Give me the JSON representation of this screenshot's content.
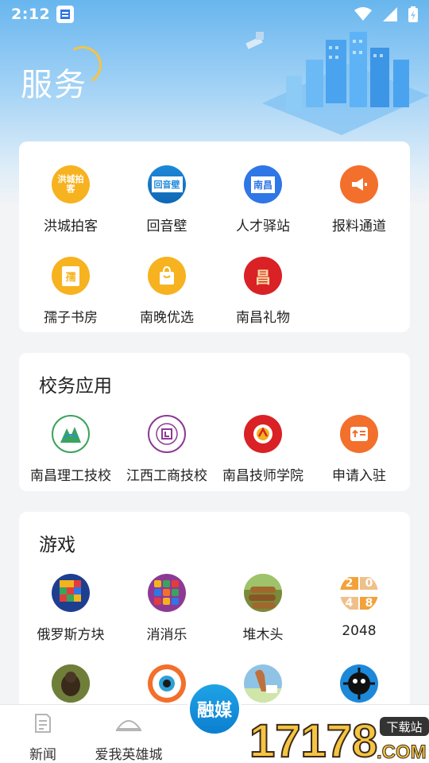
{
  "status_bar": {
    "time": "2:12"
  },
  "page": {
    "title": "服务"
  },
  "services": {
    "items": [
      {
        "label": "洪城拍客",
        "icon": "hongcheng-paike-icon",
        "icon_text": "洪城拍客",
        "color": "#f7b21f"
      },
      {
        "label": "回音壁",
        "icon": "huiyinbi-icon",
        "icon_text": "回音壁",
        "color": "#1e88d8"
      },
      {
        "label": "人才驿站",
        "icon": "talent-station-icon",
        "icon_text": "南昌",
        "color": "#2f76e6"
      },
      {
        "label": "报料通道",
        "icon": "megaphone-icon",
        "icon_text": "",
        "color": "#f36f2c"
      },
      {
        "label": "孺子书房",
        "icon": "book-icon",
        "icon_text": "孺",
        "color": "#f7b21f"
      },
      {
        "label": "南晚优选",
        "icon": "shopping-bag-icon",
        "icon_text": "",
        "color": "#f7b21f"
      },
      {
        "label": "南昌礼物",
        "icon": "gift-icon",
        "icon_text": "昌",
        "color": "#d92126"
      }
    ]
  },
  "school": {
    "title": "校务应用",
    "items": [
      {
        "label": "南昌理工技校",
        "icon": "nanchang-ligong-logo-icon",
        "color": "#3aa45c"
      },
      {
        "label": "江西工商技校",
        "icon": "jiangxi-gongshang-logo-icon",
        "color": "#8e3a95"
      },
      {
        "label": "南昌技师学院",
        "icon": "nanchang-jishi-logo-icon",
        "color": "#d92126"
      },
      {
        "label": "申请入驻",
        "icon": "apply-icon",
        "color": "#f36f2c"
      }
    ]
  },
  "games": {
    "title": "游戏",
    "items": [
      {
        "label": "俄罗斯方块",
        "icon": "tetris-icon",
        "color": "#1e3f8f"
      },
      {
        "label": "消消乐",
        "icon": "match-three-icon",
        "color": "#8e3a95"
      },
      {
        "label": "堆木头",
        "icon": "wood-stack-icon",
        "color": "#7a8a3a"
      },
      {
        "label": "2048",
        "icon": "game-2048-icon",
        "color": "#f3a23a",
        "tiles": [
          "2",
          "0",
          "4",
          "8"
        ]
      },
      {
        "label": "",
        "icon": "monkey-game-icon",
        "color": "#4b5a2a"
      },
      {
        "label": "",
        "icon": "eye-game-icon",
        "color": "#f36f2c"
      },
      {
        "label": "",
        "icon": "bird-game-icon",
        "color": "#8fc3e6"
      },
      {
        "label": "",
        "icon": "black-ball-game-icon",
        "color": "#1a1a1a"
      }
    ]
  },
  "tabbar": {
    "items": [
      {
        "label": "新闻",
        "icon": "news-icon"
      },
      {
        "label": "爱我英雄城",
        "icon": "hero-city-icon"
      },
      {
        "label": "融媒",
        "icon": "rongmei-icon"
      }
    ]
  },
  "watermark": {
    "text": "17178",
    "badge": "下载站",
    "suffix": ".COM"
  }
}
